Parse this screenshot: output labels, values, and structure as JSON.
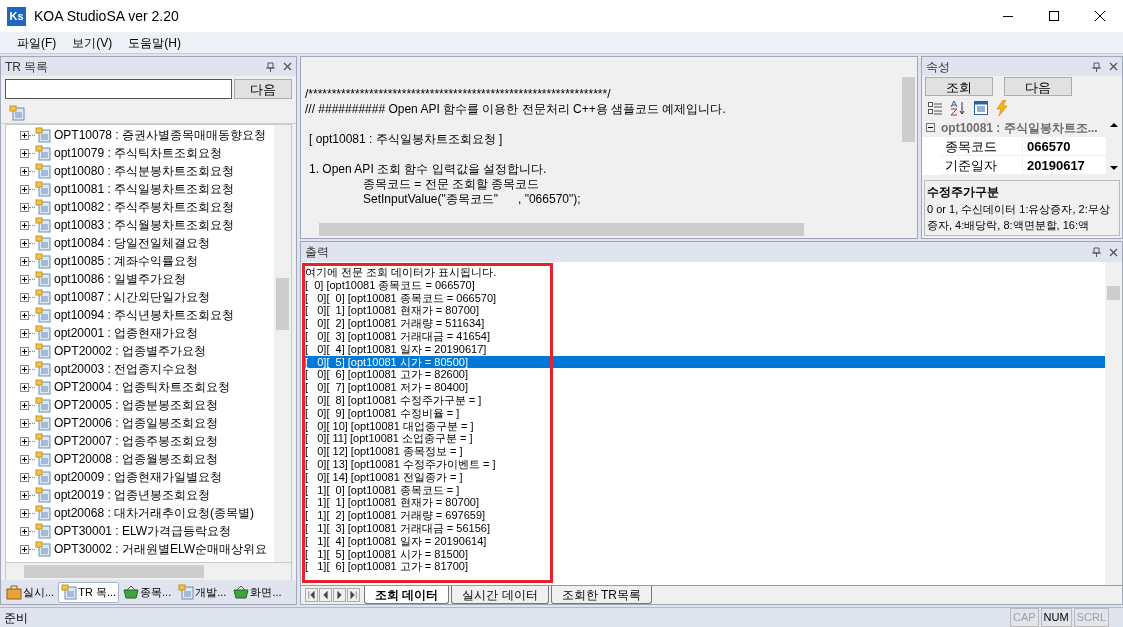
{
  "window": {
    "logo": "Ks",
    "title": "KOA StudioSA ver 2.20"
  },
  "menu": [
    "파일(F)",
    "보기(V)",
    "도움말(H)"
  ],
  "tr_panel": {
    "title": "TR 목록",
    "next_button": "다음",
    "items": [
      {
        "label": "OPT10078 : 증권사별종목매매동향요청",
        "expanded": false
      },
      {
        "label": "opt10079 : 주식틱차트조회요청",
        "expanded": false
      },
      {
        "label": "opt10080 : 주식분봉차트조회요청",
        "expanded": false
      },
      {
        "label": "opt10081 : 주식일봉차트조회요청",
        "expanded": false
      },
      {
        "label": "opt10082 : 주식주봉차트조회요청",
        "expanded": false
      },
      {
        "label": "opt10083 : 주식월봉차트조회요청",
        "expanded": false
      },
      {
        "label": "opt10084 : 당일전일체결요청",
        "expanded": false
      },
      {
        "label": "opt10085 : 계좌수익률요청",
        "expanded": false
      },
      {
        "label": "opt10086 : 일별주가요청",
        "expanded": false
      },
      {
        "label": "opt10087 : 시간외단일가요청",
        "expanded": false
      },
      {
        "label": "opt10094 : 주식년봉차트조회요청",
        "expanded": false
      },
      {
        "label": "opt20001 : 업종현재가요청",
        "expanded": false
      },
      {
        "label": "OPT20002 : 업종별주가요청",
        "expanded": false
      },
      {
        "label": "opt20003 : 전업종지수요청",
        "expanded": false
      },
      {
        "label": "OPT20004 : 업종틱차트조회요청",
        "expanded": false
      },
      {
        "label": "OPT20005 : 업종분봉조회요청",
        "expanded": false
      },
      {
        "label": "OPT20006 : 업종일봉조회요청",
        "expanded": false
      },
      {
        "label": "OPT20007 : 업종주봉조회요청",
        "expanded": false
      },
      {
        "label": "OPT20008 : 업종월봉조회요청",
        "expanded": false
      },
      {
        "label": "opt20009 : 업종현재가일별요청",
        "expanded": false
      },
      {
        "label": "opt20019 : 업종년봉조회요청",
        "expanded": false
      },
      {
        "label": "opt20068 : 대차거래추이요청(종목별)",
        "expanded": false
      },
      {
        "label": "OPT30001 : ELW가격급등락요청",
        "expanded": false
      },
      {
        "label": "OPT30002 : 거래원별ELW순매매상위요",
        "expanded": false
      }
    ],
    "bottom_tabs": [
      {
        "label": "실시...",
        "selected": false,
        "kind": "bag"
      },
      {
        "label": "TR 목...",
        "selected": true,
        "kind": "doc"
      },
      {
        "label": "종목...",
        "selected": false,
        "kind": "basket"
      },
      {
        "label": "개발...",
        "selected": false,
        "kind": "doc"
      },
      {
        "label": "화면...",
        "selected": false,
        "kind": "basket"
      }
    ]
  },
  "code": [
    [
      "/****************************************************************/",
      "/// ########## Open API 함수를 이용한 전문처리 C++용 샘플코드 예제입니다."
    ],
    [
      "[ opt10081 : 주식일봉차트조회요청 ]"
    ],
    [
      "1. Open API 조회 함수 입력값을 설정합니다.",
      "종목코드 = 전문 조회할 종목코드",
      "SetInputValue(\"종목코드\"      , \"066570\");"
    ]
  ],
  "properties": {
    "title": "속성",
    "buttons": [
      "조회",
      "다음"
    ],
    "group": {
      "label": "opt10081 : 주식일봉차트조...",
      "expanded": true
    },
    "rows": [
      {
        "name": "종목코드",
        "value": "066570"
      },
      {
        "name": "기준일자",
        "value": "20190617"
      }
    ],
    "description_title": "수정주가구분",
    "description": "0 or 1, 수신데이터 1:유상증자, 2:무상증자, 4:배당락, 8:액면분할, 16:액"
  },
  "output": {
    "title": "출력",
    "lines": [
      {
        "text": "여기에 전문 조회 데이터가 표시됩니다.",
        "selected": false
      },
      {
        "text": "[  0] [opt10081 종목코드 = 066570]",
        "selected": false
      },
      {
        "text": "[   0][  0] [opt10081 종목코드 = 066570]",
        "selected": false
      },
      {
        "text": "[   0][  1] [opt10081 현재가 = 80700]",
        "selected": false
      },
      {
        "text": "[   0][  2] [opt10081 거래량 = 511634]",
        "selected": false
      },
      {
        "text": "[   0][  3] [opt10081 거래대금 = 41654]",
        "selected": false
      },
      {
        "text": "[   0][  4] [opt10081 일자 = 20190617]",
        "selected": false
      },
      {
        "text": "[   0][  5] [opt10081 시가 = 80500]",
        "selected": true
      },
      {
        "text": "[   0][  6] [opt10081 고가 = 82600]",
        "selected": false
      },
      {
        "text": "[   0][  7] [opt10081 저가 = 80400]",
        "selected": false
      },
      {
        "text": "[   0][  8] [opt10081 수정주가구분 = ]",
        "selected": false
      },
      {
        "text": "[   0][  9] [opt10081 수정비율 = ]",
        "selected": false
      },
      {
        "text": "[   0][ 10] [opt10081 대업종구분 = ]",
        "selected": false
      },
      {
        "text": "[   0][ 11] [opt10081 소업종구분 = ]",
        "selected": false
      },
      {
        "text": "[   0][ 12] [opt10081 종목정보 = ]",
        "selected": false
      },
      {
        "text": "[   0][ 13] [opt10081 수정주가이벤트 = ]",
        "selected": false
      },
      {
        "text": "[   0][ 14] [opt10081 전일종가 = ]",
        "selected": false
      },
      {
        "text": "[   1][  0] [opt10081 종목코드 = ]",
        "selected": false
      },
      {
        "text": "[   1][  1] [opt10081 현재가 = 80700]",
        "selected": false
      },
      {
        "text": "[   1][  2] [opt10081 거래량 = 697659]",
        "selected": false
      },
      {
        "text": "[   1][  3] [opt10081 거래대금 = 56156]",
        "selected": false
      },
      {
        "text": "[   1][  4] [opt10081 일자 = 20190614]",
        "selected": false
      },
      {
        "text": "[   1][  5] [opt10081 시가 = 81500]",
        "selected": false
      },
      {
        "text": "[   1][  6] [opt10081 고가 = 81700]",
        "selected": false
      }
    ],
    "tabs": [
      {
        "label": "조회 데이터",
        "selected": true
      },
      {
        "label": "실시간 데이터",
        "selected": false
      },
      {
        "label": "조회한 TR목록",
        "selected": false
      }
    ]
  },
  "status_bar": {
    "text": "준비",
    "indicators": [
      {
        "label": "CAP",
        "on": false
      },
      {
        "label": "NUM",
        "on": true
      },
      {
        "label": "SCRL",
        "on": false
      }
    ]
  }
}
